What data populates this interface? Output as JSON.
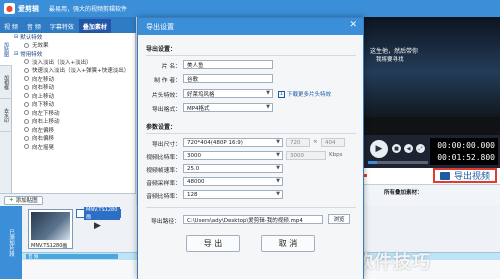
{
  "app": {
    "name": "爱剪辑",
    "slogan": "最易用，强大的视频剪辑软件",
    "tabs": [
      "视 频",
      "音 频",
      "字幕特效",
      "叠加素材"
    ]
  },
  "vnav": [
    {
      "label": "加贴图"
    },
    {
      "label": "加相框"
    },
    {
      "label": "去水印"
    }
  ],
  "effects": {
    "groups": [
      {
        "name": "默认特效",
        "items": [
          "无效果"
        ]
      },
      {
        "name": "常用特效",
        "items": [
          "淡入淡出（淡入+淡出）",
          "快速淡入淡出（淡入+弹簧+快速淡出）",
          "向左移动",
          "向右移动",
          "向上移动",
          "向下移动",
          "向左下移动",
          "向右上移动",
          "向左偏移",
          "向右偏移",
          "向左摇晃"
        ]
      }
    ]
  },
  "timeline": {
    "add_pic": "添加贴图",
    "side_label": "已添加片段",
    "clips": [
      "MNV.TS1280画",
      "MNV.TS1280画"
    ],
    "audio_label": "音 频"
  },
  "preview": {
    "sub1": "这生他，然后带你",
    "sub2": "我将要寻找"
  },
  "player": {
    "time_current": "00:00:00.000",
    "time_total": "00:01:52.800",
    "progress": 0.15
  },
  "export_button": "导出视频",
  "added_effects_header": "所有叠加素材：",
  "watermark": "软件技巧",
  "dialog": {
    "title": "导出设置",
    "export_section": "导出设置：",
    "param_section": "参数设置：",
    "fields": {
      "name_label": "片  名：",
      "name_value": "美人鱼",
      "author_label": "制 作 者：",
      "author_value": "谷歌",
      "intro_label": "片头特效：",
      "intro_value": "好莱坞风格",
      "download_link": "下载更多片头特效",
      "format_label": "导出格式：",
      "format_value": "MP4格式"
    },
    "params": {
      "size_label": "导出尺寸：",
      "size_value": "720*404(480P 16:9)",
      "size_w": "720",
      "size_h": "404",
      "size_x": "×",
      "vbitrate_label": "视频比特率：",
      "vbitrate_value": "3000",
      "vbitrate_unit_value": "3000",
      "vbitrate_unit": "Kbps",
      "fps_label": "视频帧速率：",
      "fps_value": "25.0",
      "asample_label": "音频采样率：",
      "asample_value": "48000",
      "abitrate_label": "音频比特率：",
      "abitrate_value": "128"
    },
    "path_label": "导出路径：",
    "path_value": "C:\\Users\\ady\\Desktop\\爱剪辑-我的视频.mp4",
    "browse": "浏览",
    "export_btn": "导 出",
    "cancel_btn": "取 消"
  }
}
